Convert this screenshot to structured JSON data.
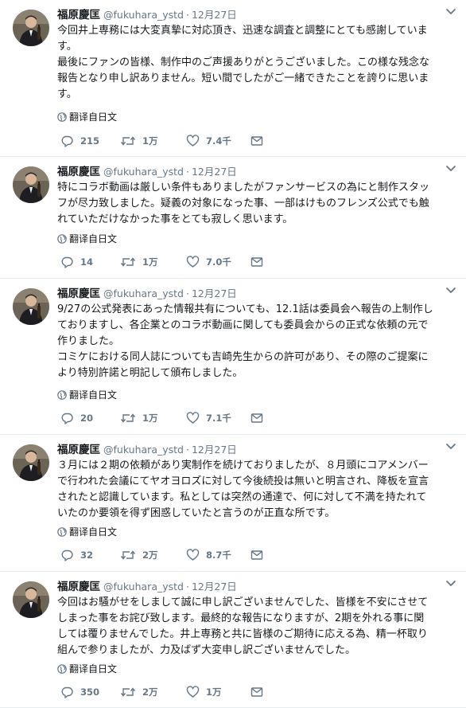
{
  "colors": {
    "text": "#14171a",
    "secondary": "#657786",
    "divider": "#e6ecf0",
    "accent": "#1da1f2"
  },
  "tweets": [
    {
      "name": "福原慶匡",
      "handle": "@fukuhara_ystd",
      "sep": "·",
      "time": "12月27日",
      "lines": [
        "今回井上専務には大変真摯に対応頂き、迅速な調査と調整にとても感謝していま",
        "す。",
        "最後にファンの皆様、制作中のご声援ありがとうございました。この様な残念な",
        "報告となり申し訳ありません。短い間でしたがご一緒できたことを誇りに思いま",
        "す。"
      ],
      "translate": "翻译自日文",
      "replies": "215",
      "retweets": "1万",
      "likes": "7.4千"
    },
    {
      "name": "福原慶匡",
      "handle": "@fukuhara_ystd",
      "sep": "·",
      "time": "12月27日",
      "lines": [
        "特にコラボ動画は厳しい条件もありましたがファンサービスの為にと制作スタッ",
        "フが尽力致しました。疑義の対象になった事、一部はけものフレンズ公式でも触",
        "れていただけなかった事をとても寂しく思います。"
      ],
      "translate": "翻译自日文",
      "replies": "14",
      "retweets": "1万",
      "likes": "7.0千"
    },
    {
      "name": "福原慶匡",
      "handle": "@fukuhara_ystd",
      "sep": "·",
      "time": "12月27日",
      "lines": [
        "9/27の公式発表にあった情報共有についても、12.1話は委員会へ報告の上制作し",
        "ておりますし、各企業とのコラボ動画に関しても委員会からの正式な依頼の元で",
        "作りました。",
        "コミケにおける同人誌についても吉崎先生からの許可があり、その際のご提案に",
        "より特別許諾と明記して頒布しました。"
      ],
      "translate": "翻译自日文",
      "replies": "20",
      "retweets": "1万",
      "likes": "7.1千"
    },
    {
      "name": "福原慶匡",
      "handle": "@fukuhara_ystd",
      "sep": "·",
      "time": "12月27日",
      "lines": [
        "３月には２期の依頼があり実制作を続けておりましたが、８月頭にコアメンバー",
        "で行われた会議にてヤオヨロズに対して今後続投は無いと明言され、降板を宣言",
        "されたと認識しています。私としては突然の通達で、何に対して不満を持たれて",
        "いたのか要領を得ず困惑していたと言うのが正直な所です。"
      ],
      "translate": "翻译自日文",
      "replies": "32",
      "retweets": "2万",
      "likes": "8.7千"
    },
    {
      "name": "福原慶匡",
      "handle": "@fukuhara_ystd",
      "sep": "·",
      "time": "12月27日",
      "lines": [
        "今回はお騒がせをしまして誠に申し訳ございませんでした、皆様を不安にさせて",
        "しまった事をお詫び致します。最終的な報告になりますが、2期を外れる事に関",
        "しては覆りませんでした。井上専務と共に皆様のご期待に応える為、精一杯取り",
        "組んで参りましたが、力及ばず大変申し訳ございませんでした。"
      ],
      "translate": "翻译自日文",
      "replies": "350",
      "retweets": "2万",
      "likes": "1万"
    }
  ]
}
